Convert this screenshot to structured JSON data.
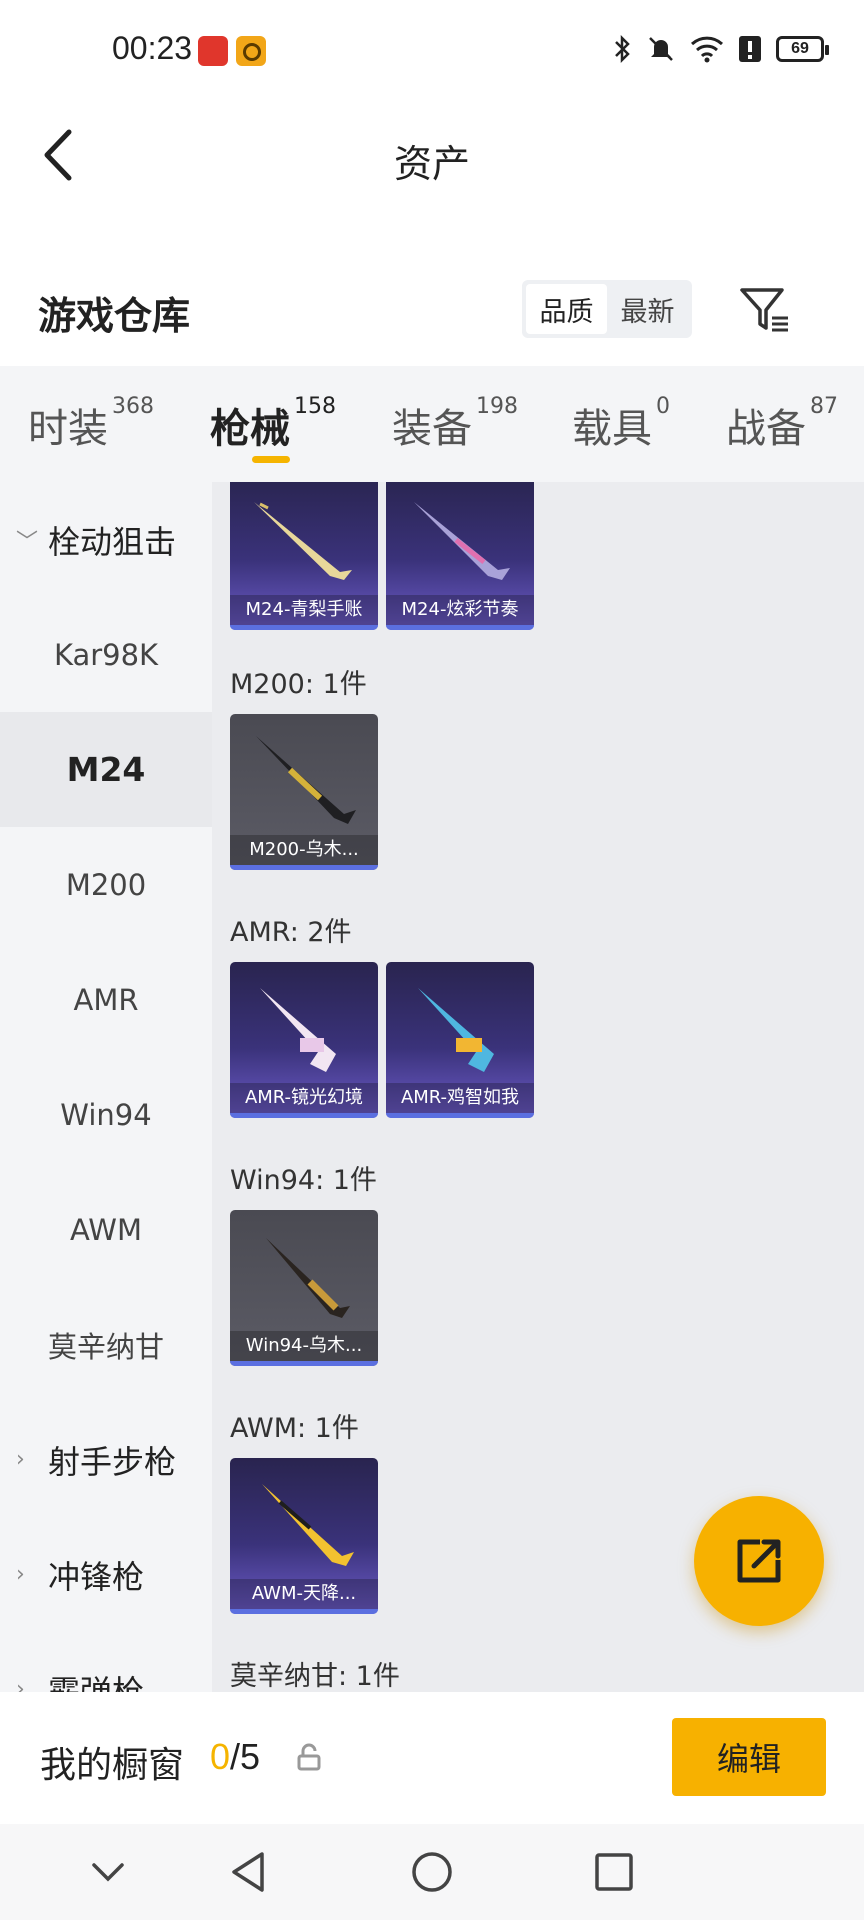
{
  "status_bar": {
    "time": "00:23",
    "battery": "69"
  },
  "header": {
    "title": "资产"
  },
  "warehouse": {
    "title": "游戏仓库",
    "sort_options": [
      "品质",
      "最新"
    ],
    "active_sort": "品质"
  },
  "tabs": [
    {
      "label": "时装",
      "count": "368"
    },
    {
      "label": "枪械",
      "count": "158"
    },
    {
      "label": "装备",
      "count": "198"
    },
    {
      "label": "载具",
      "count": "0"
    },
    {
      "label": "战备",
      "count": "87"
    }
  ],
  "sidebar": {
    "groups": [
      {
        "label": "栓动狙击"
      },
      {
        "label": "射手步枪"
      },
      {
        "label": "冲锋枪"
      },
      {
        "label": "霰弹枪"
      }
    ],
    "items": [
      "Kar98K",
      "M24",
      "M200",
      "AMR",
      "Win94",
      "AWM",
      "莫辛纳甘"
    ],
    "active": "M24"
  },
  "sections": {
    "m24_cards": [
      "M24-青梨手账",
      "M24-炫彩节奏"
    ],
    "m200_title": "M200: 1件",
    "m200_cards": [
      "M200-乌木..."
    ],
    "amr_title": "AMR: 2件",
    "amr_cards": [
      "AMR-镜光幻境",
      "AMR-鸡智如我"
    ],
    "win94_title": "Win94: 1件",
    "win94_cards": [
      "Win94-乌木..."
    ],
    "awm_title": "AWM: 1件",
    "awm_cards": [
      "AWM-天降..."
    ],
    "mosin_title": "莫辛纳甘: 1件"
  },
  "showcase": {
    "title": "我的橱窗",
    "current": "0",
    "total": "/5",
    "edit_label": "编辑"
  },
  "colors": {
    "accent": "#f7b100",
    "tab_underline": "#f5b400"
  },
  "icons": [
    "back-arrow-icon",
    "filter-icon",
    "share-icon",
    "lock-icon",
    "nav-collapse-icon",
    "nav-back-icon",
    "nav-home-icon",
    "nav-recents-icon",
    "bluetooth-icon",
    "mute-icon",
    "wifi-icon",
    "alert-icon"
  ]
}
